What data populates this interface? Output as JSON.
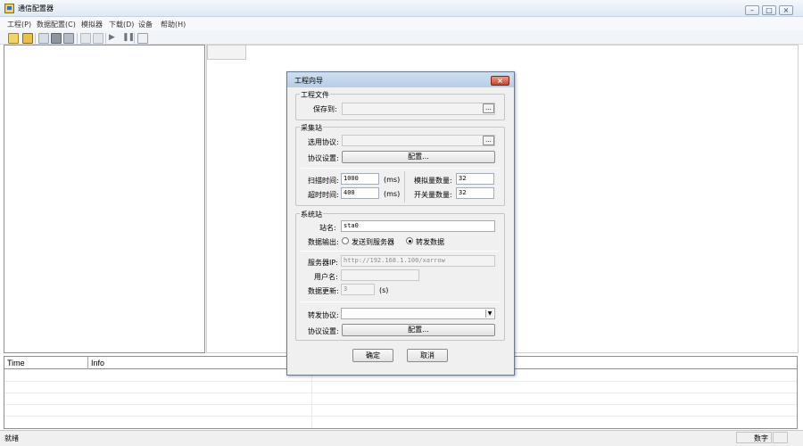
{
  "app": {
    "title": "通信配置器"
  },
  "menu": [
    "工程(P)",
    "数据配置(C)",
    "模拟器",
    "下载(D)",
    "设备",
    "帮助(H)"
  ],
  "log": {
    "columns": [
      "Time",
      "Info"
    ]
  },
  "status": {
    "left": "就绪",
    "num": "数字"
  },
  "dialog": {
    "title": "工程向导",
    "project_group": "工程文件",
    "save_to_label": "保存到:",
    "save_to_value": "",
    "browse_label": "...",
    "collector_group": "采集站",
    "protocol_label": "选用协议:",
    "protocol_value": "",
    "protocol_browse": "...",
    "protocol_setting_label": "协议设置:",
    "config_button": "配置...",
    "scan_time_label": "扫描时间:",
    "scan_time_value": "1000",
    "scan_unit": "(ms)",
    "timeout_label": "超时时间:",
    "timeout_value": "400",
    "timeout_unit": "(ms)",
    "analog_label": "模拟量数量:",
    "analog_value": "32",
    "switch_label": "开关量数量:",
    "switch_value": "32",
    "system_group": "系统站",
    "station_label": "站名:",
    "station_value": "sta0",
    "output_label": "数据输出:",
    "radio_server": "发送到服务器",
    "radio_forward": "转发数据",
    "server_ip_label": "服务器IP:",
    "server_ip_value": "http://192.168.1.100/xarrow",
    "user_label": "用户名:",
    "user_value": "",
    "update_label": "数据更新:",
    "update_value": "3",
    "update_unit": "(s)",
    "forward_protocol_label": "转发协议:",
    "forward_protocol_value": "",
    "forward_setting_label": "协议设置:",
    "forward_config_button": "配置...",
    "ok_button": "确定",
    "cancel_button": "取消"
  }
}
